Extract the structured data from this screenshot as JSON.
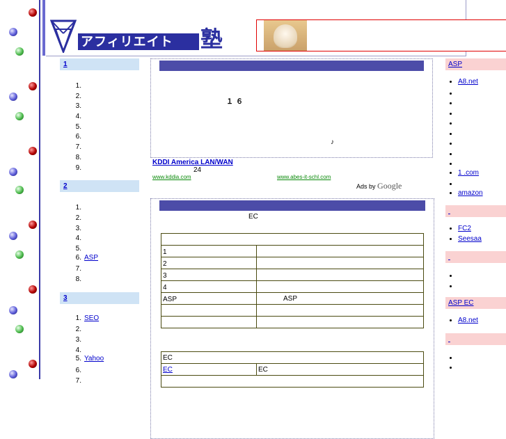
{
  "header": {
    "logo_text": "アフィリエイト",
    "logo_kanji": "塾"
  },
  "left_nav": [
    {
      "title": "1",
      "items": [
        "1.",
        "2.",
        "3.",
        "4.",
        "5.",
        "6.",
        "7.",
        "8.",
        "9."
      ],
      "labels": [
        "",
        "",
        "",
        "",
        "",
        "",
        "",
        "",
        ""
      ]
    },
    {
      "title": "2",
      "items": [
        "1.",
        "2.",
        "3.",
        "4.",
        "5.",
        "6.",
        "7.",
        "8."
      ],
      "labels": [
        "",
        "",
        "",
        "",
        "",
        "ASP",
        "",
        ""
      ]
    },
    {
      "title": "3",
      "items": [
        "1.",
        "2.",
        "3.",
        "4.",
        "5.",
        "6.",
        "7."
      ],
      "labels": [
        "SEO",
        "",
        "",
        "",
        "Yahoo",
        "",
        ""
      ]
    }
  ],
  "main": {
    "ad_box": {
      "body_text": "１６",
      "note_char": "♪",
      "ads": [
        {
          "title": "KDDI America  LAN/WAN",
          "sub": "24",
          "url": "www.kddia.com"
        },
        {
          "title": "",
          "sub": "",
          "url": "www.abes-it-schl.com"
        }
      ],
      "ads_by": "Ads by",
      "google": "Google"
    },
    "section": {
      "title": "EC",
      "table1_rows": [
        {
          "label": "1",
          "value": ""
        },
        {
          "label": "2",
          "value": ""
        },
        {
          "label": "3",
          "value": ""
        },
        {
          "label": "4",
          "value": ""
        },
        {
          "label": "ASP",
          "value": "ASP"
        },
        {
          "label": "",
          "value": ""
        },
        {
          "label": "",
          "value": ""
        }
      ],
      "table2_header": "EC",
      "table2_rows": [
        {
          "label": "EC",
          "value": "EC"
        }
      ]
    }
  },
  "right_nav": [
    {
      "title": "ASP",
      "items": [
        "A8.net",
        "",
        "",
        "",
        "",
        "",
        "",
        "",
        "",
        "1 .com",
        "",
        "amazon"
      ]
    },
    {
      "title": "",
      "items": [
        "FC2",
        "Seesaa"
      ]
    },
    {
      "title": "",
      "items": [
        "",
        ""
      ]
    },
    {
      "title": "ASP   EC",
      "items": [
        "A8.net"
      ]
    },
    {
      "title": "",
      "items": [
        "",
        ""
      ]
    }
  ]
}
